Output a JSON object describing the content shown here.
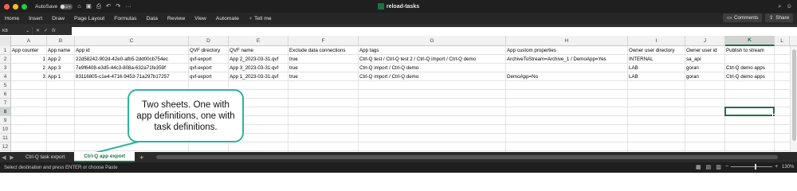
{
  "window": {
    "title": "reload-tasks",
    "autosave_label": "AutoSave",
    "autosave_state": "OFF",
    "traffic_colors": [
      "#ff5f57",
      "#febc2e",
      "#28c840"
    ]
  },
  "ribbon": {
    "tabs": [
      "Home",
      "Insert",
      "Draw",
      "Page Layout",
      "Formulas",
      "Data",
      "Review",
      "View",
      "Automate"
    ],
    "tell_me": "Tell me",
    "comments_label": "Comments",
    "share_label": "Share"
  },
  "formula_bar": {
    "name_box": "K8",
    "fx_label": "fx",
    "value": ""
  },
  "sheet": {
    "columns": [
      "A",
      "B",
      "C",
      "D",
      "E",
      "F",
      "G",
      "H",
      "I",
      "J",
      "K",
      "L"
    ],
    "selected_column": "K",
    "selected_row": "8",
    "rows": [
      "1",
      "2",
      "3",
      "4",
      "5",
      "6",
      "7",
      "8",
      "9",
      "10",
      "11",
      "12"
    ],
    "cells": {
      "r1": [
        "App counter",
        "App name",
        "App id",
        "QVF directory",
        "QVF name",
        "Exclude data connections",
        "App tags",
        "App custom properties",
        "Owner user directory",
        "Owner user id",
        "Publish to stream",
        ""
      ],
      "r2": [
        "1",
        "App 2",
        "22d58242-902d-42e0-afb5-2dd00cb754ec",
        "qvf-export",
        "App 2_2023-03-31.qvf",
        "true",
        "Ctrl-Q test / Ctrl-Q test 2 / Ctrl-Q import / Ctrl-Q demo",
        "ArchiveToStream=Archive_1 / DemoApp=Yes",
        "INTERNAL",
        "sa_api",
        "",
        ""
      ],
      "r3": [
        "2",
        "App 3",
        "7e9f6408-e3d5-44c3-808a-632a71fe359f",
        "qvf-export",
        "App 3_2023-03-31.qvf",
        "true",
        "Ctrl-Q import / Ctrl-Q demo",
        "",
        "LAB",
        "goran",
        "Ctrl-Q demo apps",
        ""
      ],
      "r4": [
        "3",
        "App 1",
        "83116805-c1e4-4716-9453-71a297b17257",
        "qvf-export",
        "App 1_2023-03-31.qvf",
        "true",
        "Ctrl-Q import / Ctrl-Q demo",
        "DemoApp=No",
        "LAB",
        "goran",
        "Ctrl-Q demo apps",
        ""
      ]
    }
  },
  "callout": {
    "text": "Two sheets. One with app definitions, one with task definitions.",
    "border_color": "#2db49c"
  },
  "sheet_tabs": [
    {
      "label": "Ctrl-Q task export",
      "active": false
    },
    {
      "label": "Ctrl-Q app export",
      "active": true
    }
  ],
  "status": {
    "message": "Select destination and press ENTER or choose Paste",
    "zoom": "130%"
  },
  "colors": {
    "excel_green": "#1e7145",
    "chrome_dark": "#1f1f1f"
  }
}
